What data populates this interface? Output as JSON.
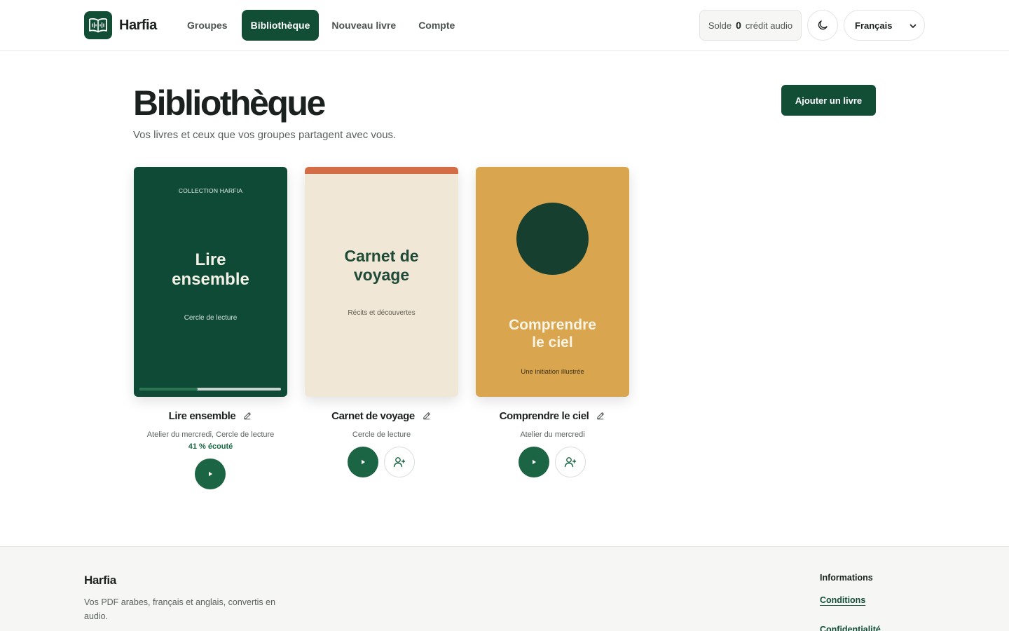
{
  "header": {
    "brand": "Harfia",
    "nav": [
      {
        "label": "Groupes",
        "active": false
      },
      {
        "label": "Bibliothèque",
        "active": true
      },
      {
        "label": "Nouveau livre",
        "active": false
      },
      {
        "label": "Compte",
        "active": false
      }
    ],
    "balance": {
      "label": "Solde",
      "value": "0",
      "unit": "crédit audio"
    },
    "theme_icon": "moon-icon",
    "language": "Français"
  },
  "main": {
    "title": "Bibliothèque",
    "subtitle": "Vos livres et ceux que vos groupes partagent avec vous.",
    "add_button": "Ajouter un livre",
    "books": [
      {
        "title": "Lire ensemble",
        "groups": "Atelier du mercredi, Cercle de lecture",
        "progress_text": "41 % écouté",
        "progress": 0.41,
        "cover": {
          "collection": "COLLECTION HARFIA",
          "title_line1": "Lire",
          "title_line2": "ensemble",
          "subtitle": "Cercle de lecture",
          "background": "#0f4a37"
        },
        "has_share": false
      },
      {
        "title": "Carnet de voyage",
        "groups": "Cercle de lecture",
        "cover": {
          "title_line1": "Carnet de",
          "title_line2": "voyage",
          "subtitle": "Récits et découvertes",
          "background": "#f1e7d6",
          "accent": "#d46c45"
        },
        "has_share": true
      },
      {
        "title": "Comprendre le ciel",
        "groups": "Atelier du mercredi",
        "cover": {
          "title_line1": "Comprendre",
          "title_line2": "le ciel",
          "subtitle": "Une initiation illustrée",
          "background": "#d9a64f",
          "accent": "#173f2f"
        },
        "has_share": true
      }
    ]
  },
  "footer": {
    "brand": "Harfia",
    "description": "Vos PDF arabes, français et anglais, convertis en audio.",
    "info_heading": "Informations",
    "links": [
      "Conditions",
      "Confidentialité"
    ]
  },
  "colors": {
    "primary": "#124d36",
    "accent_green": "#1c6544",
    "text": "#1b211e",
    "muted": "#5a625d"
  }
}
